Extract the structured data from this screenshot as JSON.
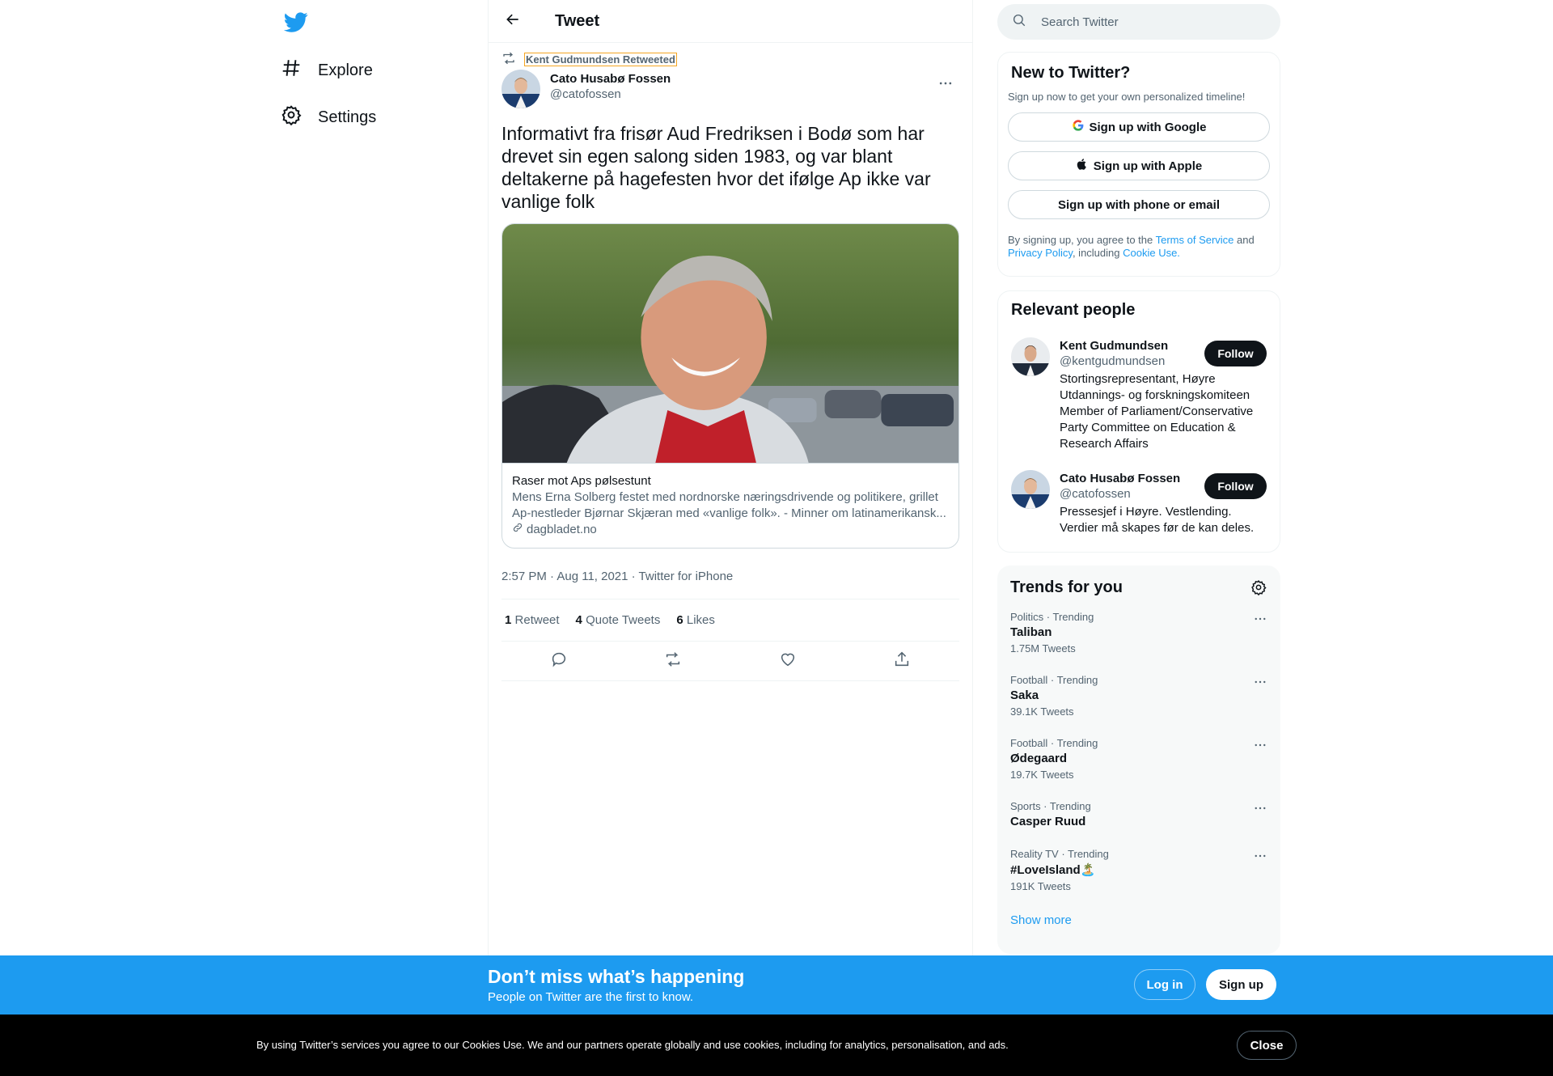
{
  "nav": {
    "logo_icon": "twitter-bird-icon",
    "items": [
      {
        "label": "Explore",
        "icon": "hashtag-icon"
      },
      {
        "label": "Settings",
        "icon": "gear-icon"
      }
    ]
  },
  "header": {
    "title": "Tweet"
  },
  "tweet": {
    "retweeted_by": "Kent Gudmundsen Retweeted",
    "author_name": "Cato Husabø Fossen",
    "author_handle": "@catofossen",
    "text": "Informativt fra frisør Aud Fredriksen i Bodø som har drevet sin egen salong siden 1983, og var blant deltakerne på hagefesten hvor det ifølge Ap ikke var vanlige folk",
    "card": {
      "title": "Raser mot Aps pølsestunt",
      "description": "Mens Erna Solberg festet med nordnorske næringsdrivende og politikere, grillet Ap-nestleder Bjørnar Skjæran med «vanlige folk». - Minner om latinamerikansk...",
      "domain": "dagbladet.no"
    },
    "timestamp": "2:57 PM · Aug 11, 2021 · Twitter for iPhone",
    "stats": [
      {
        "count": "1",
        "label": "Retweet"
      },
      {
        "count": "4",
        "label": "Quote Tweets"
      },
      {
        "count": "6",
        "label": "Likes"
      }
    ]
  },
  "search": {
    "placeholder": "Search Twitter"
  },
  "new_to_twitter": {
    "title": "New to Twitter?",
    "subtitle": "Sign up now to get your own personalized timeline!",
    "google": "Sign up with Google",
    "apple": "Sign up with Apple",
    "phone": "Sign up with phone or email",
    "terms_prefix": "By signing up, you agree to the ",
    "terms_link": "Terms of Service",
    "terms_and": " and ",
    "privacy_link": "Privacy Policy",
    "terms_including": ", including ",
    "cookie_link": "Cookie Use."
  },
  "relevant_people": {
    "title": "Relevant people",
    "follow_label": "Follow",
    "people": [
      {
        "name": "Kent Gudmundsen",
        "handle": "@kentgudmundsen",
        "bio": "Stortingsrepresentant, Høyre Utdannings- og forskningskomiteen Member of Parliament/Conservative Party Committee on Education & Research Affairs"
      },
      {
        "name": "Cato Husabø Fossen",
        "handle": "@catofossen",
        "bio": "Pressesjef i Høyre. Vestlending. Verdier må skapes før de kan deles."
      }
    ]
  },
  "trends": {
    "title": "Trends for you",
    "items": [
      {
        "category": "Politics · Trending",
        "name": "Taliban",
        "count": "1.75M Tweets"
      },
      {
        "category": "Football · Trending",
        "name": "Saka",
        "count": "39.1K Tweets"
      },
      {
        "category": "Football · Trending",
        "name": "Ødegaard",
        "count": "19.7K Tweets"
      },
      {
        "category": "Sports · Trending",
        "name": "Casper Ruud",
        "count": ""
      },
      {
        "category": "Reality TV · Trending",
        "name": "#LoveIsland🏝️",
        "count": "191K Tweets"
      }
    ],
    "show_more": "Show more"
  },
  "bottom_bar": {
    "title": "Don’t miss what’s happening",
    "subtitle": "People on Twitter are the first to know.",
    "login": "Log in",
    "signup": "Sign up"
  },
  "cookie_bar": {
    "text": "By using Twitter’s services you agree to our Cookies Use. We and our partners operate globally and use cookies, including for analytics, personalisation, and ads.",
    "close": "Close"
  },
  "colors": {
    "brand": "#1d9bf0",
    "text": "#0f1419",
    "muted": "#536471"
  }
}
